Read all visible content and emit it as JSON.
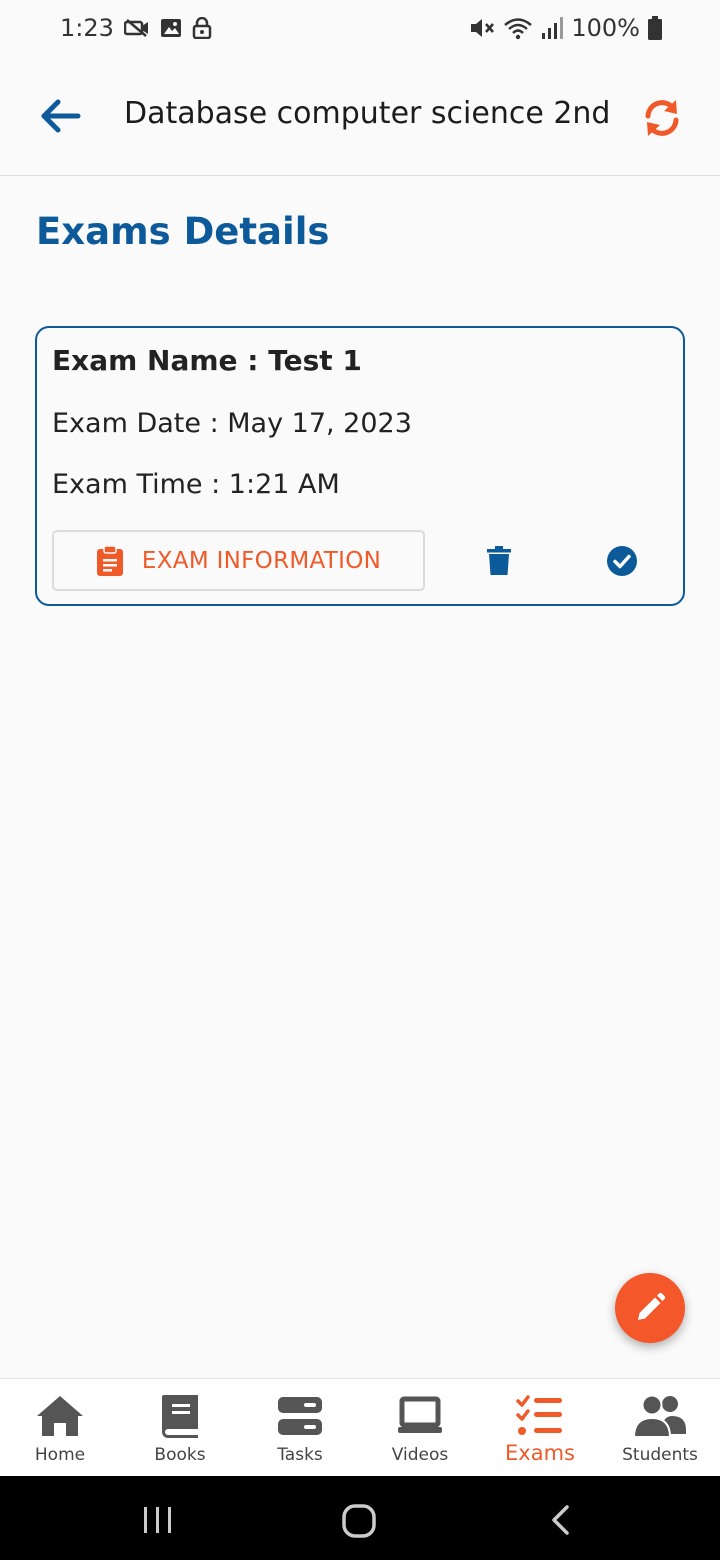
{
  "status_bar": {
    "time": "1:23",
    "battery": "100%",
    "left_icons": [
      "camera-off-icon",
      "image-icon",
      "lock-icon"
    ],
    "right_icons": [
      "mute-icon",
      "wifi-icon",
      "signal-icon",
      "battery-icon"
    ]
  },
  "app_bar": {
    "title": "Database computer science 2nd",
    "back_icon": "arrow-left-icon",
    "refresh_icon": "refresh-icon"
  },
  "section_title": "Exams Details",
  "exam": {
    "name": "Exam Name : Test 1",
    "date": "Exam Date : May 17, 2023",
    "time": "Exam Time : 1:21 AM",
    "info_button_label": "EXAM INFORMATION"
  },
  "bottom_nav": {
    "items": [
      {
        "label": "Home",
        "icon": "home-icon"
      },
      {
        "label": "Books",
        "icon": "book-icon"
      },
      {
        "label": "Tasks",
        "icon": "tasks-icon"
      },
      {
        "label": "Videos",
        "icon": "laptop-icon"
      },
      {
        "label": "Exams",
        "icon": "checklist-icon",
        "active": true
      },
      {
        "label": "Students",
        "icon": "users-icon"
      }
    ]
  },
  "colors": {
    "primary": "#0d5a9a",
    "accent": "#f05a28",
    "background": "#fafafa"
  }
}
